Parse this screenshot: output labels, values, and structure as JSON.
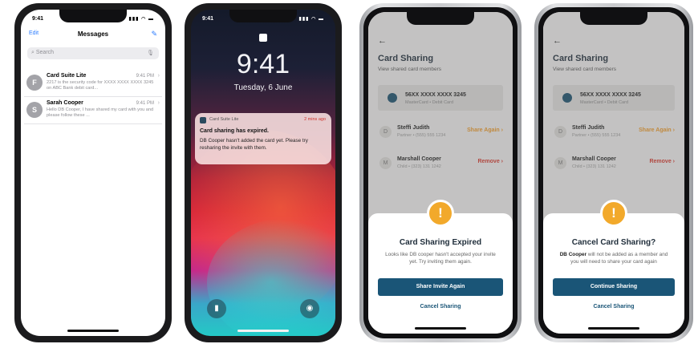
{
  "phone1": {
    "status_time": "9:41",
    "status_icons": "▮▮▮ ◠ ▬",
    "edit_label": "Edit",
    "title": "Messages",
    "compose_glyph": "✎",
    "search_placeholder": "Search",
    "mic_glyph": "🎙",
    "threads": [
      {
        "initial": "F",
        "name": "Card Suite Lite",
        "time": "9:41 PM",
        "preview": "2217 is the security code for XXXX XXXX XXXX 3245 on ABC Bank debit card..."
      },
      {
        "initial": "S",
        "name": "Sarah Cooper",
        "time": "9:41 PM",
        "preview": "Hello DB Cooper, I have shared my card with you and please follow these ..."
      }
    ]
  },
  "phone2": {
    "status_time": "9:41",
    "status_icons": "▮▮▮ ◠ ▬",
    "lock_time": "9:41",
    "lock_date": "Tuesday, 6 June",
    "notification": {
      "app": "Card Suite Lite",
      "time": "2 mins ago",
      "title": "Card sharing has expired.",
      "body": "DB Cooper hasn't added the card yet. Please try resharing the invite with them."
    },
    "flashlight_glyph": "▮",
    "camera_glyph": "◉"
  },
  "card_sharing": {
    "back_glyph": "←",
    "title": "Card Sharing",
    "subtitle": "View shared card members",
    "card_number": "56XX XXXX XXXX 3245",
    "card_type": "MasterCard • Debit Card",
    "members": [
      {
        "initial": "D",
        "name": "Steffi Judith",
        "role": "Partner • (555) 555 1234",
        "action": "Share Again ›"
      },
      {
        "initial": "M",
        "name": "Marshall Cooper",
        "role": "Child • (323) 131 1242",
        "action": "Remove ›"
      }
    ]
  },
  "phone3_sheet": {
    "title": "Card Sharing Expired",
    "body": "Looks like DB cooper hasn't accepted your invite yet. Try inviting them again.",
    "primary_button": "Share Invite Again",
    "link": "Cancel Sharing"
  },
  "phone4_sheet": {
    "title": "Cancel Card Sharing?",
    "body_bold": "DB Cooper",
    "body_rest": " will not be added as a member and you will need to share your card again",
    "primary_button": "Continue Sharing",
    "link": "Cancel Sharing"
  },
  "warn_glyph": "!",
  "colors": {
    "accent": "#1a5577",
    "warning": "#f2a92b",
    "remove": "#d1382e",
    "share_again": "#e8972a",
    "ios_blue": "#2b7cff"
  }
}
